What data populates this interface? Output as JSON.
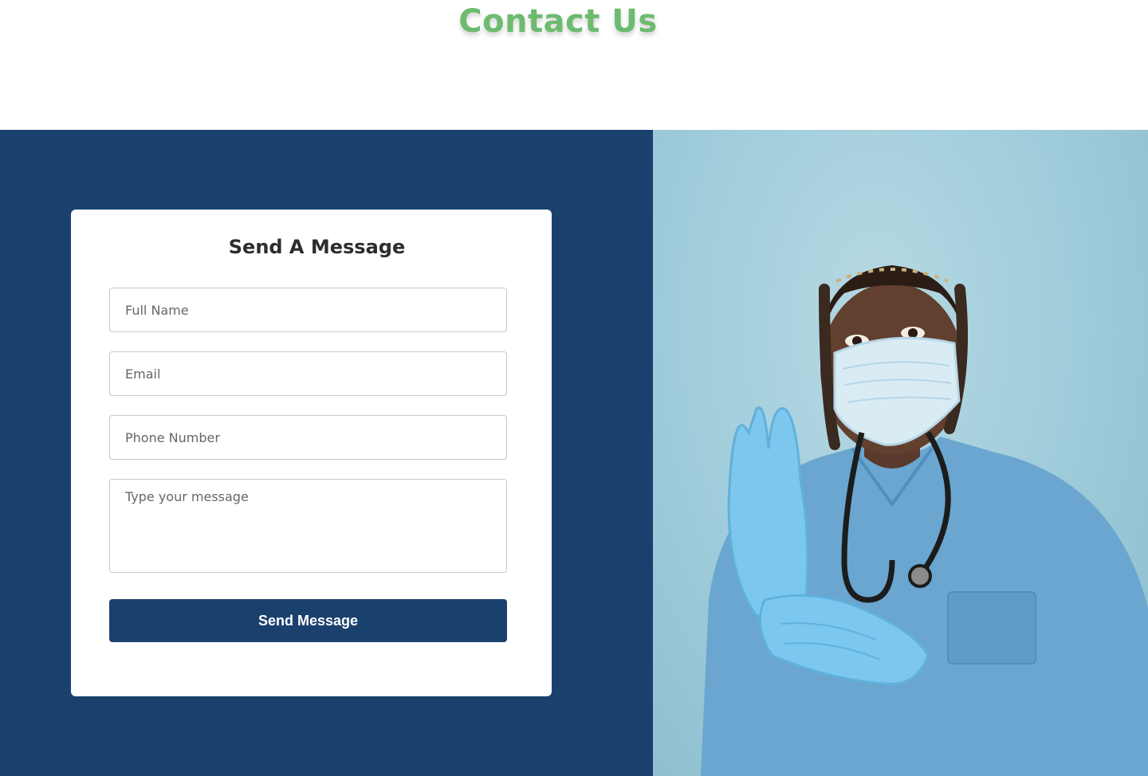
{
  "page": {
    "title": "Contact Us"
  },
  "form": {
    "title": "Send A Message",
    "full_name": {
      "placeholder": "Full Name",
      "value": ""
    },
    "email": {
      "placeholder": "Email",
      "value": ""
    },
    "phone": {
      "placeholder": "Phone Number",
      "value": ""
    },
    "message": {
      "placeholder": "Type your message",
      "value": ""
    },
    "submit_label": "Send Message"
  },
  "colors": {
    "title_green": "#6dbb6f",
    "navy": "#1a416e",
    "photo_background": "#a6d0dc"
  },
  "image": {
    "subject": "nurse-in-scrubs-wearing-mask-and-gloves"
  }
}
